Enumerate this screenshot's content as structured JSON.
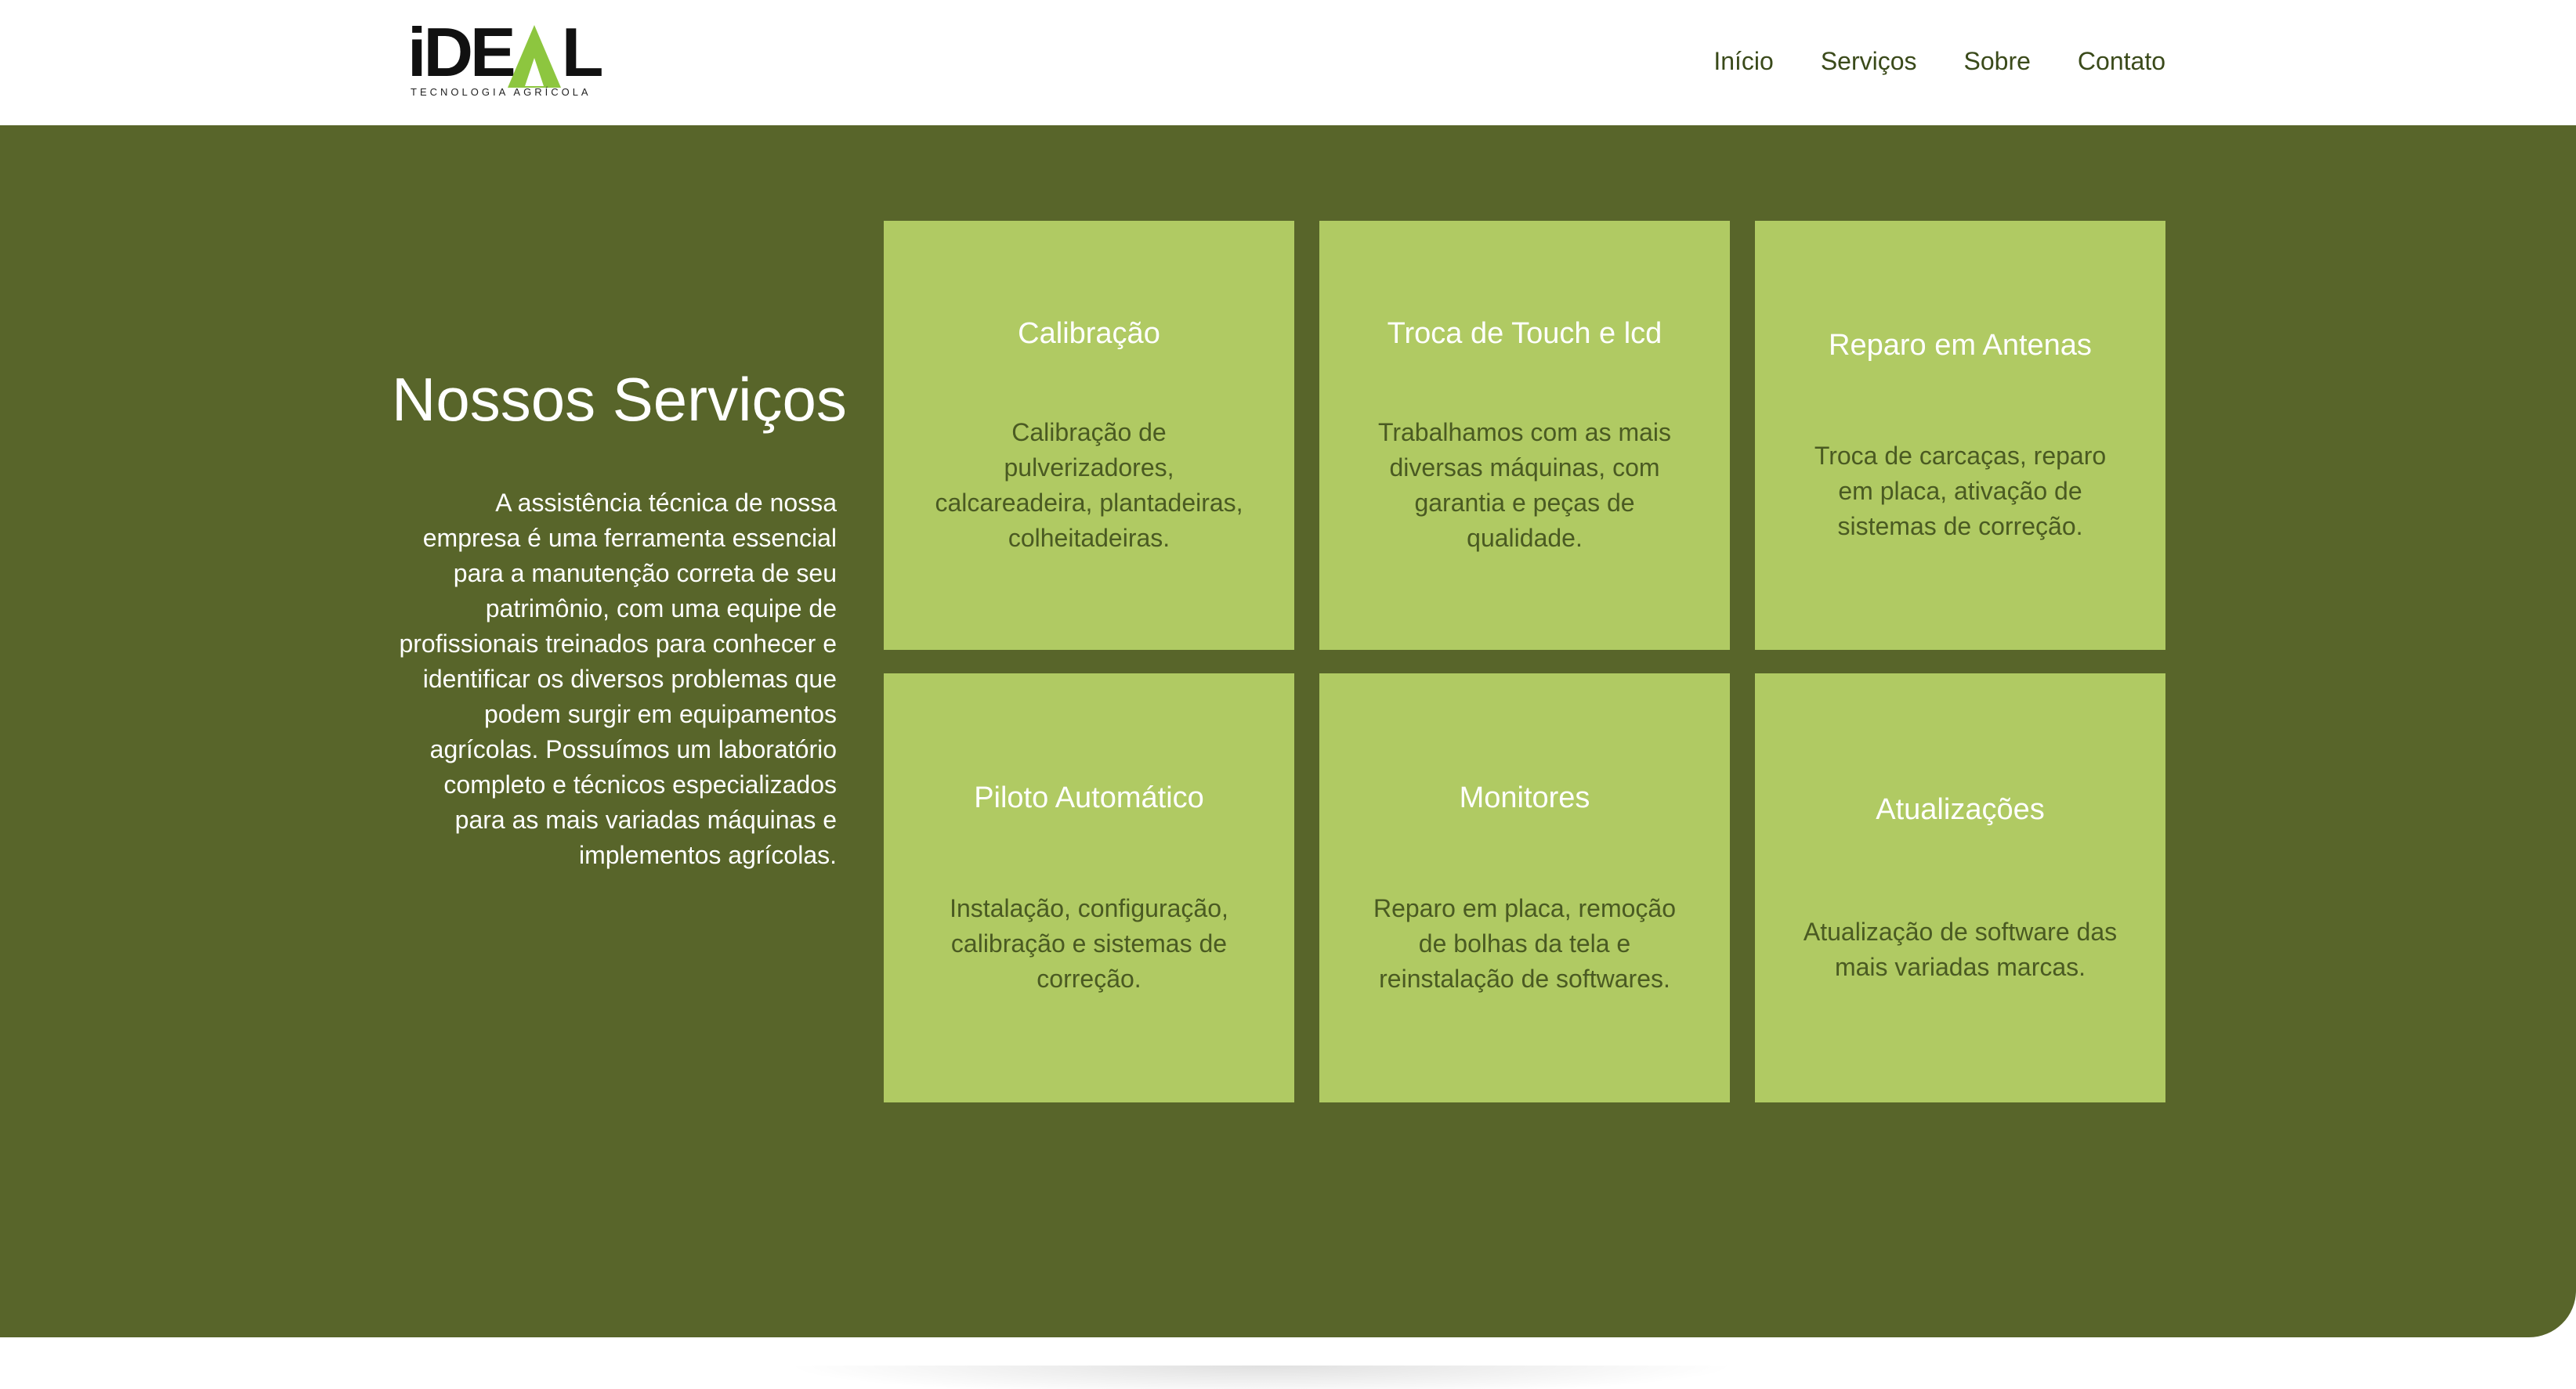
{
  "header": {
    "logo": {
      "word_dark": "iDE",
      "word_end": "L",
      "subtitle": "TECNOLOGIA   AGRÍCOLA"
    },
    "nav": [
      {
        "label": "Início"
      },
      {
        "label": "Serviços"
      },
      {
        "label": "Sobre"
      },
      {
        "label": "Contato"
      }
    ]
  },
  "services": {
    "title": "Nossos Serviços",
    "description": "A assistência técnica de nossa empresa é uma ferramenta essencial para a manutenção correta de seu patrimônio, com uma equipe de profissionais treinados para conhecer e identificar os diversos problemas que podem surgir em equipamentos agrícolas. Possuímos um laboratório completo e técnicos especializados para as mais variadas máquinas e implementos agrícolas.",
    "cards": [
      {
        "title": "Calibração",
        "text": "Calibração de pulverizadores, calcareadeira, plantadeiras, colheitadeiras."
      },
      {
        "title": "Troca de Touch e lcd",
        "text": "Trabalhamos com as mais diversas máquinas, com garantia e peças de qualidade."
      },
      {
        "title": "Reparo em Antenas",
        "text": "Troca de carcaças, reparo em placa, ativação de sistemas de correção."
      },
      {
        "title": "Piloto Automático",
        "text": "Instalação, configuração, calibração e sistemas de correção."
      },
      {
        "title": "Monitores",
        "text": "Reparo em placa, remoção de bolhas da tela e reinstalação de softwares."
      },
      {
        "title": "Atualizações",
        "text": "Atualização de software das mais variadas marcas."
      }
    ]
  },
  "colors": {
    "section_bg": "#58652a",
    "card_bg": "#b0ca63",
    "logo_green": "#8dc63f",
    "nav_text": "#3a4a1a"
  }
}
